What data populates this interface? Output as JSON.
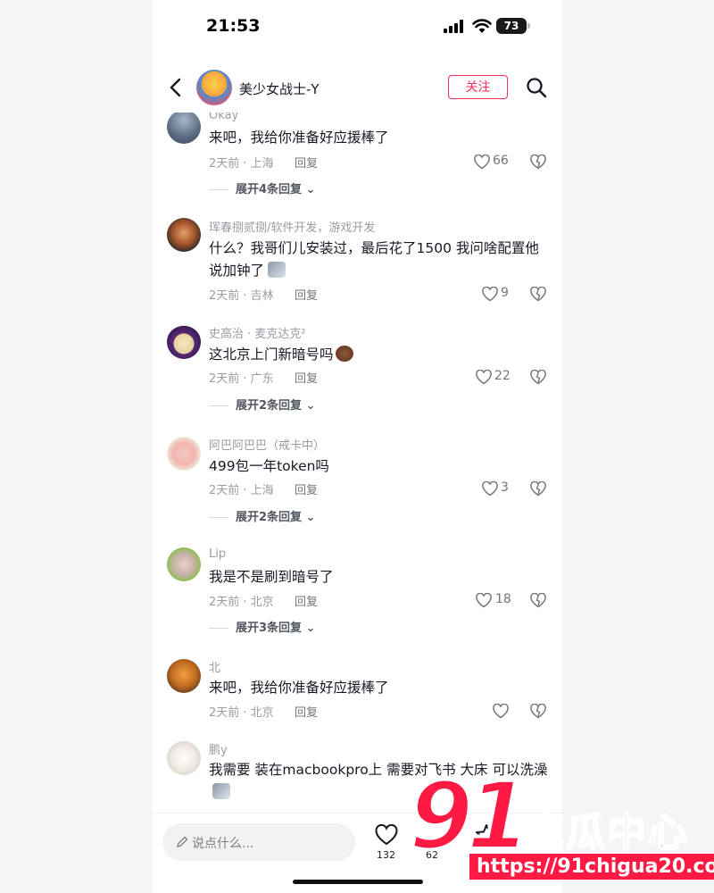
{
  "status_bar": {
    "time": "21:53",
    "battery": "73"
  },
  "header": {
    "username": "美少女战士-Y",
    "follow_label": "关注"
  },
  "comments": [
    {
      "name": "Okay",
      "text": "来吧，我给你准备好应援棒了",
      "time_location": "2天前 · 上海",
      "reply_label": "回复",
      "likes": "66",
      "expand": "展开4条回复"
    },
    {
      "name": "珲春捌贰捌/软件开发，游戏开发",
      "text": "什么？我哥们儿安装过，最后花了1500 我问啥配置他说加钟了",
      "time_location": "2天前 · 吉林",
      "reply_label": "回复",
      "likes": "9"
    },
    {
      "name": "史高治 · 麦克达克²",
      "text": "这北京上门新暗号吗",
      "time_location": "2天前 · 广东",
      "reply_label": "回复",
      "likes": "22",
      "expand": "展开2条回复"
    },
    {
      "name": "阿巴阿巴巴（戒卡中）",
      "text": "499包一年token吗",
      "time_location": "2天前 · 上海",
      "reply_label": "回复",
      "likes": "3",
      "expand": "展开2条回复"
    },
    {
      "name": "Lip",
      "text": "我是不是刷到暗号了",
      "time_location": "2天前 · 北京",
      "reply_label": "回复",
      "likes": "18",
      "expand": "展开3条回复"
    },
    {
      "name": "北",
      "text": "来吧，我给你准备好应援棒了",
      "time_location": "2天前 · 北京",
      "reply_label": "回复",
      "likes": ""
    },
    {
      "name": "鹏y",
      "text": "我需要 装在macbookpro上 需要对飞书 大床 可以洗澡",
      "time_location": "",
      "reply_label": "",
      "likes": ""
    }
  ],
  "bottom_bar": {
    "placeholder": "说点什么...",
    "like_count": "132",
    "star_count": "62"
  },
  "watermark": {
    "number": "91",
    "name": "吃瓜中心",
    "url": "https://91chigua20.com"
  },
  "colors": {
    "accent": "#fe2c55",
    "watermark": "#ff1a44"
  }
}
